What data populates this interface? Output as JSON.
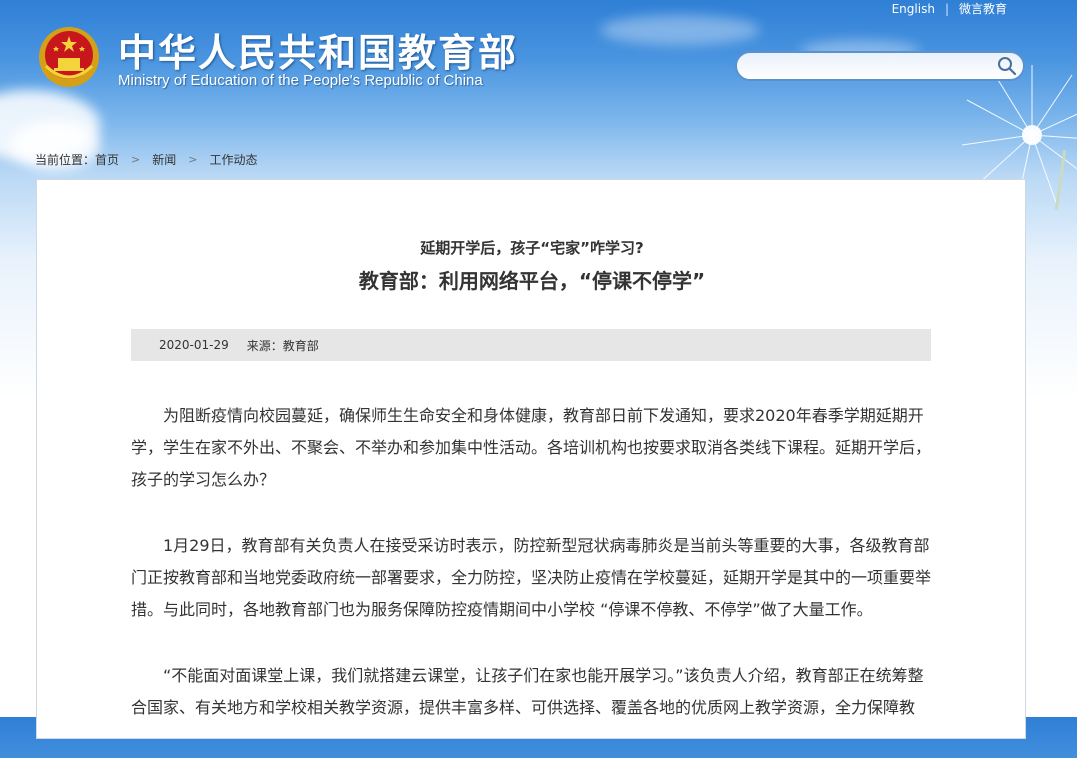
{
  "header": {
    "title_cn": "中华人民共和国教育部",
    "title_en": "Ministry of Education of the People's Republic of China",
    "links": {
      "english": "English",
      "separator": "|",
      "weibo": "微言教育"
    },
    "search": {
      "placeholder": "",
      "value": ""
    }
  },
  "breadcrumb": {
    "label": "当前位置：",
    "items": [
      "首页",
      "新闻",
      "工作动态"
    ]
  },
  "article": {
    "subtitle": "延期开学后，孩子“宅家”咋学习?",
    "headline": "教育部：利用网络平台，“停课不停学”",
    "date": "2020-01-29",
    "source": "来源：教育部",
    "paragraphs": [
      "为阻断疫情向校园蔓延，确保师生生命安全和身体健康，教育部日前下发通知，要求2020年春季学期延期开学，学生在家不外出、不聚会、不举办和参加集中性活动。各培训机构也按要求取消各类线下课程。延期开学后，孩子的学习怎么办？",
      "1月29日，教育部有关负责人在接受采访时表示，防控新型冠状病毒肺炎是当前头等重要的大事，各级教育部门正按教育部和当地党委政府统一部署要求，全力防控，坚决防止疫情在学校蔓延，延期开学是其中的一项重要举措。与此同时，各地教育部门也为服务保障防控疫情期间中小学校 “停课不停教、不停学”做了大量工作。",
      "“不能面对面课堂上课，我们就搭建云课堂，让孩子们在家也能开展学习。”该负责人介绍，教育部正在统筹整合国家、有关地方和学校相关教学资源，提供丰富多样、可供选择、覆盖各地的优质网上教学资源，全力保障教"
    ]
  },
  "colors": {
    "sky_top": "#2f7fd6",
    "panel_border": "#cfd8e3",
    "meta_bg": "#e6e6e6",
    "text": "#333333"
  }
}
